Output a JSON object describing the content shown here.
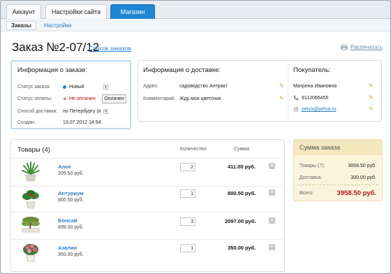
{
  "tabs": [
    {
      "label": "Аккаунт"
    },
    {
      "label": "Настройки сайта"
    },
    {
      "label": "Магазин"
    }
  ],
  "subtabs": [
    {
      "label": "Заказы"
    },
    {
      "label": "Настройки"
    }
  ],
  "header": {
    "title": "Заказ №2-07/12",
    "orders_link": "Список заказов",
    "print_label": "Распечатать"
  },
  "order_info": {
    "heading": "Информация о заказе:",
    "status_label": "Статус заказа:",
    "status_value": "Новый",
    "payment_label": "Статус оплаты:",
    "payment_value": "Не оплачен",
    "pay_button": "Оплачен",
    "delivery_label": "Способ доставки:",
    "delivery_value": "по Петербургу (в",
    "created_label": "Создан:",
    "created_value": "13.07.2012 14:54"
  },
  "delivery_info": {
    "heading": "Информация о доставке:",
    "address_label": "Адрес:",
    "address_value": "садоводство Антракт",
    "comment_label": "Комментарий:",
    "comment_value": "Жду мои цветочки"
  },
  "buyer": {
    "heading": "Покупатель:",
    "name": "Матрена Ивановна",
    "phone": "9112066455",
    "email": "petya@petya.ru"
  },
  "goods": {
    "heading": "Товары",
    "count": "(4)",
    "qty_col": "Количество",
    "sum_col": "Сумма",
    "items": [
      {
        "name": "Алое",
        "price": "205.50 руб.",
        "qty": "2",
        "sum": "411.00 руб."
      },
      {
        "name": "Антуриум",
        "price": "800.50 руб.",
        "qty": "1",
        "sum": "800.50 руб."
      },
      {
        "name": "Бонсай",
        "price": "699.00 руб.",
        "qty": "3",
        "sum": "2097.00 руб."
      },
      {
        "name": "Азалия",
        "price": "350.00 руб.",
        "qty": "1",
        "sum": "350.00 руб."
      }
    ]
  },
  "totals": {
    "heading": "Сумма заказа",
    "goods_label": "Товары (7):",
    "goods_value": "3658.50 руб.",
    "delivery_label": "Доставка:",
    "delivery_value": "300.00 руб.",
    "total_label": "Всего:",
    "total_value": "3958.50 руб."
  },
  "colors": {
    "accent": "#1f86d3",
    "link": "#2a7ec9",
    "price_red": "#b3181a",
    "panel_yellow": "#fbf4dd"
  }
}
